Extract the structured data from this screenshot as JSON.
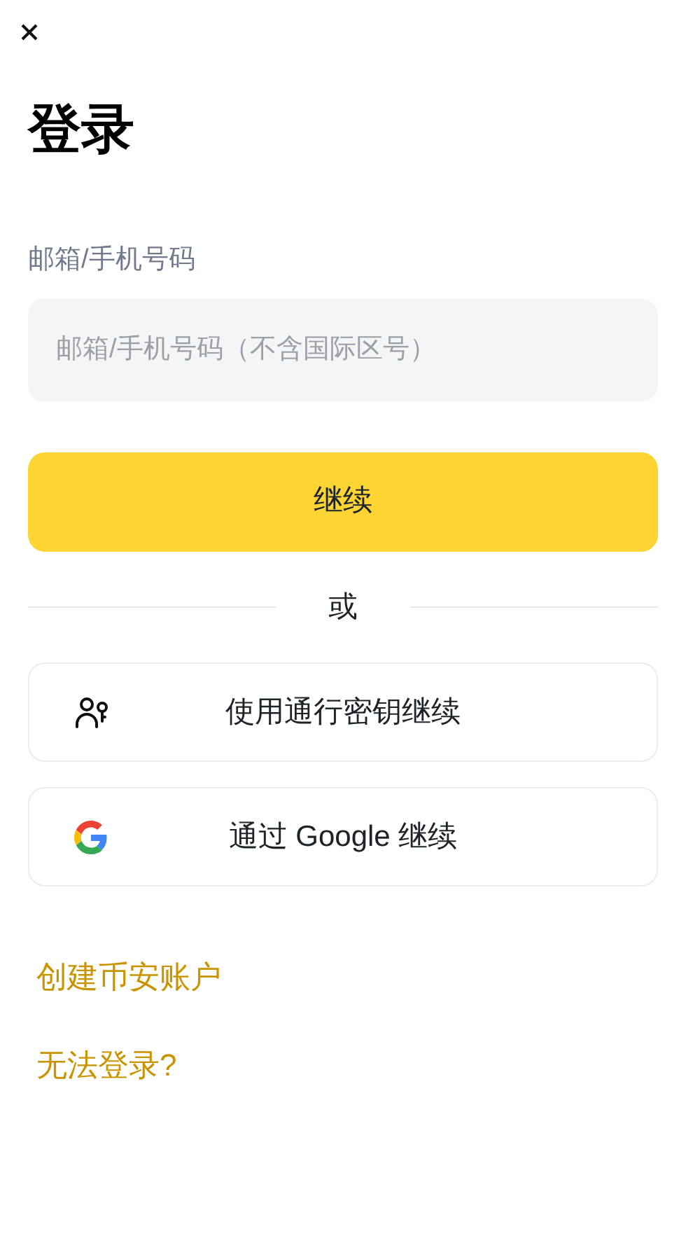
{
  "title": "登录",
  "field": {
    "label": "邮箱/手机号码",
    "placeholder": "邮箱/手机号码（不含国际区号）"
  },
  "continue_button": "继续",
  "divider": "或",
  "alt_buttons": [
    {
      "kind": "passkey",
      "label": "使用通行密钥继续"
    },
    {
      "kind": "google",
      "label": "通过 Google 继续"
    }
  ],
  "links": [
    "创建币安账户",
    "无法登录?"
  ]
}
